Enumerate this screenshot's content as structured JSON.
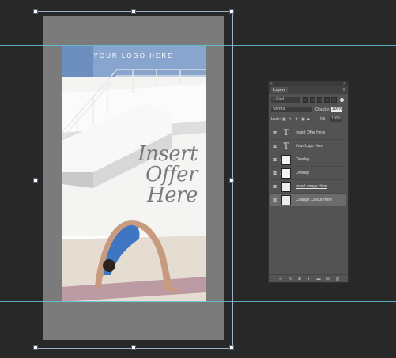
{
  "artboard": {
    "logo_text": "YOUR LOGO HERE",
    "offer_lines": [
      "Insert",
      "Offer",
      "Here"
    ]
  },
  "layers_panel": {
    "tab_label": "Layers",
    "filter_kind": "Kind",
    "blend_mode": "Normal",
    "opacity_label": "Opacity:",
    "opacity_value": "100%",
    "lock_label": "Lock:",
    "fill_label": "Fill:",
    "fill_value": "100%",
    "layers": [
      {
        "name": "Insert Offer Here",
        "kind": "type"
      },
      {
        "name": "Your Logo Here",
        "kind": "type"
      },
      {
        "name": "Overlay",
        "kind": "fill"
      },
      {
        "name": "Overlay",
        "kind": "fill"
      },
      {
        "name": "Insert Image Here",
        "kind": "image"
      },
      {
        "name": "Change Colour Here",
        "kind": "image"
      }
    ],
    "type_glyph": "T",
    "footer_icons": [
      "link-icon",
      "fx-icon",
      "mask-icon",
      "adjustment-icon",
      "folder-icon",
      "new-layer-icon",
      "trash-icon"
    ],
    "footer_fx": "fx"
  },
  "colors": {
    "canvas_bg": "#282828",
    "artboard_bg": "#7b7b7b",
    "guide": "#5ec7d8",
    "panel_bg": "#535353",
    "selected_layer": "#6b6b6b"
  }
}
